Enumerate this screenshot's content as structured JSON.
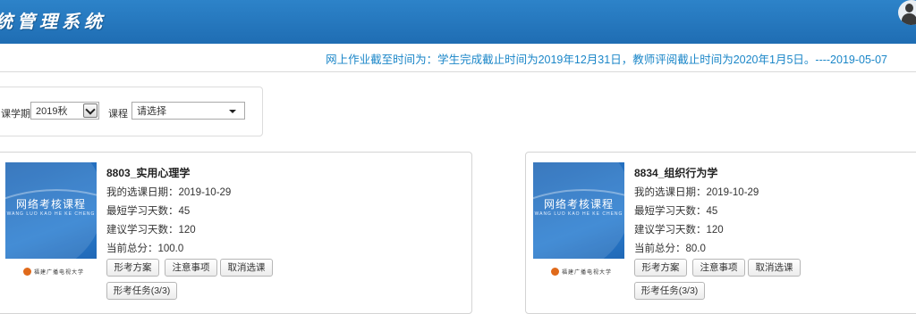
{
  "header": {
    "title": "统管理系统",
    "avatar_icon": "user-avatar-icon"
  },
  "notice": "网上作业截至时间为：学生完成截止时间为2019年12月31日，教师评阅截止时间为2020年1月5日。----2019-05-07",
  "filters": {
    "term_label": "课学期",
    "term_value": "2019秋",
    "course_label": "课程",
    "course_value": "请选择"
  },
  "courses": [
    {
      "cover": {
        "title": "网络考核课程",
        "subtitle": "WANG LUO KAO HE KE CHENG",
        "university": "福建广播电视大学"
      },
      "title": "8803_实用心理学",
      "date": "我的选课日期：2019-10-29",
      "min_days": "最短学习天数：45",
      "suggest_days": "建议学习天数：120",
      "score": "当前总分：100.0",
      "buttons": [
        "形考方案",
        "注意事项",
        "取消选课"
      ],
      "task_button": "形考任务(3/3)"
    },
    {
      "cover": {
        "title": "网络考核课程",
        "subtitle": "WANG LUO KAO HE KE CHENG",
        "university": "福建广播电视大学"
      },
      "title": "8834_组织行为学",
      "date": "我的选课日期：2019-10-29",
      "min_days": "最短学习天数：45",
      "suggest_days": "建议学习天数：120",
      "score": "当前总分：80.0",
      "buttons": [
        "形考方案",
        "注意事项",
        "取消选课"
      ],
      "task_button": "形考任务(3/3)"
    }
  ]
}
